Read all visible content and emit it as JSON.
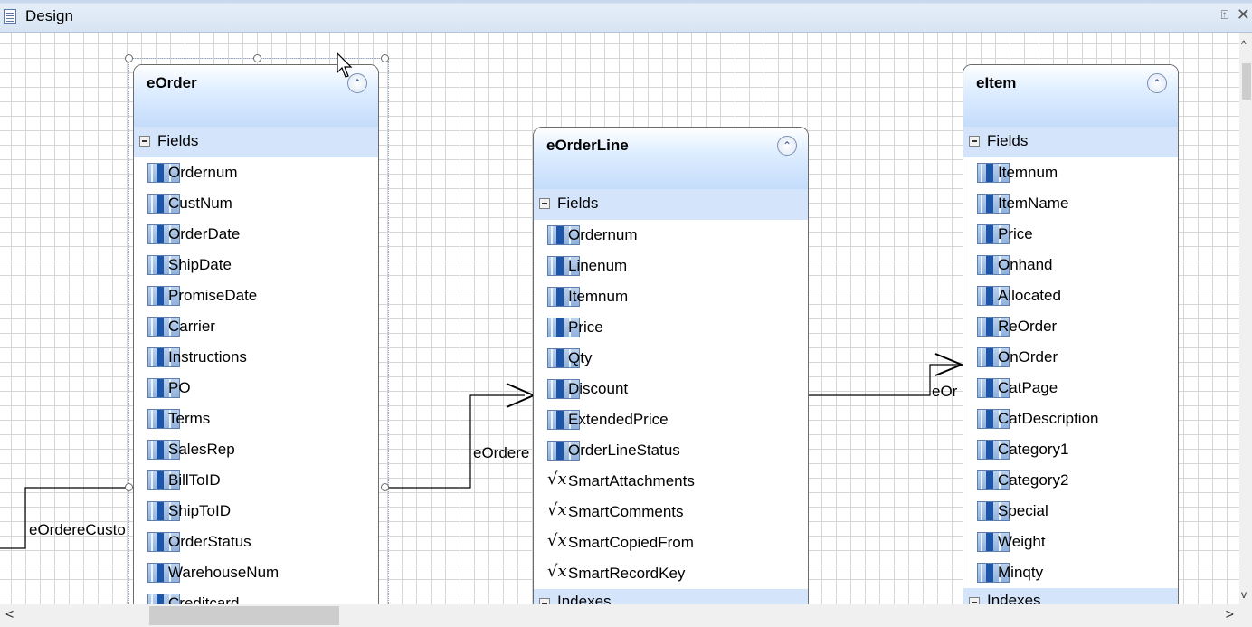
{
  "window": {
    "title": "Design",
    "pin_glyph": "⍐",
    "close_glyph": "✕"
  },
  "entities": {
    "eorder": {
      "name": "eOrder",
      "fields_label": "Fields",
      "fields": [
        "Ordernum",
        "CustNum",
        "OrderDate",
        "ShipDate",
        "PromiseDate",
        "Carrier",
        "Instructions",
        "PO",
        "Terms",
        "SalesRep",
        "BillToID",
        "ShipToID",
        "OrderStatus",
        "WarehouseNum",
        "Creditcard"
      ]
    },
    "eorderline": {
      "name": "eOrderLine",
      "fields_label": "Fields",
      "fields": [
        "Ordernum",
        "Linenum",
        "Itemnum",
        "Price",
        "Qty",
        "Discount",
        "ExtendedPrice",
        "OrderLineStatus"
      ],
      "calc_fields": [
        "SmartAttachments",
        "SmartComments",
        "SmartCopiedFrom",
        "SmartRecordKey"
      ],
      "indexes_label": "Indexes"
    },
    "eitem": {
      "name": "eItem",
      "fields_label": "Fields",
      "fields": [
        "Itemnum",
        "ItemName",
        "Price",
        "Onhand",
        "Allocated",
        "ReOrder",
        "OnOrder",
        "CatPage",
        "CatDescription",
        "Category1",
        "Category2",
        "Special",
        "Weight",
        "Minqty"
      ],
      "indexes_label": "Indexes"
    }
  },
  "relations": {
    "left_label": "eOrdereCusto",
    "middle_label": "eOrdere",
    "right_label": "eOr"
  },
  "icons": {
    "collapse": "chevrons-up-icon",
    "field": "table-column-icon",
    "calc": "sqrt-x-icon"
  },
  "scroll": {
    "left_glyph": "<",
    "right_glyph": ">",
    "up_glyph": "^",
    "down_glyph": "v"
  }
}
